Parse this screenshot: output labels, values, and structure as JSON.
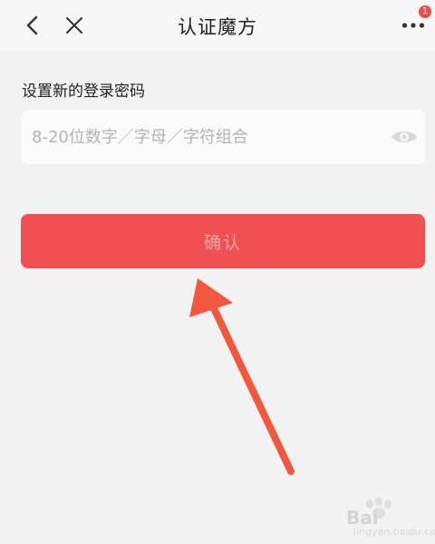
{
  "header": {
    "title": "认证魔方",
    "back_icon": "chevron-left-icon",
    "close_icon": "close-icon",
    "more_icon": "more-dots-icon",
    "notification_badge": "1",
    "badge_color": "#f14b4b"
  },
  "form": {
    "section_label": "设置新的登录密码",
    "password_placeholder": "8-20位数字／字母／字符组合",
    "password_value": "",
    "visibility_icon": "eye-icon",
    "confirm_label": "确认",
    "confirm_color": "#f15052"
  },
  "annotation": {
    "arrow_color": "#f2583e",
    "arrow_icon": "arrow-pointer-icon"
  },
  "watermark": {
    "brand": "Bai",
    "sub": "jingyan.baidu.com"
  }
}
